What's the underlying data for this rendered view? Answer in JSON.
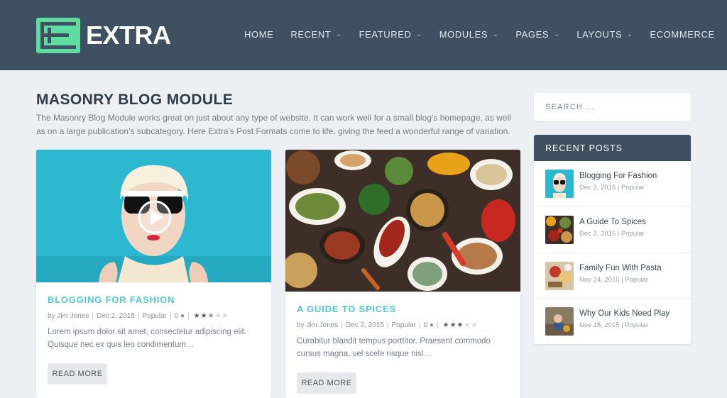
{
  "header": {
    "logo_text": "EXTRA",
    "nav": [
      {
        "label": "HOME",
        "has_dropdown": false
      },
      {
        "label": "RECENT",
        "has_dropdown": true
      },
      {
        "label": "FEATURED",
        "has_dropdown": true
      },
      {
        "label": "MODULES",
        "has_dropdown": true
      },
      {
        "label": "PAGES",
        "has_dropdown": true
      },
      {
        "label": "LAYOUTS",
        "has_dropdown": true
      },
      {
        "label": "ECOMMERCE",
        "has_dropdown": false
      }
    ]
  },
  "main": {
    "title": "MASONRY BLOG MODULE",
    "description": "The Masonry Blog Module works great on just about any type of website. It can work well for a small blog’s homepage, as well as on a large publication’s subcategory. Here Extra’s Post Formats come to life, giving the feed a wonderful range of variation.",
    "posts": [
      {
        "title": "BLOGGING FOR FASHION",
        "author": "by Jim Jones",
        "date": "Dec 2, 2015",
        "category": "Popular",
        "comments": "0",
        "rating": 2.5,
        "excerpt": "Lorem ipsum dolor sit amet, consectetur adipiscing elit. Quisque nec ex quis leo condimentum…",
        "read_more": "READ MORE"
      },
      {
        "title": "A GUIDE TO SPICES",
        "author": "by Jim Jones",
        "date": "Dec 2, 2015",
        "category": "Popular",
        "comments": "0",
        "rating": 3,
        "excerpt": "Curabitur blandit tempus porttitor. Praesent commodo cursus magna, vel scele risque nisl…",
        "read_more": "READ MORE"
      }
    ]
  },
  "sidebar": {
    "search_placeholder": "SEARCH ...",
    "recent_title": "RECENT POSTS",
    "recent_posts": [
      {
        "title": "Blogging For Fashion",
        "date": "Dec 2, 2015",
        "category": "Popular"
      },
      {
        "title": "A Guide To Spices",
        "date": "Dec 2, 2015",
        "category": "Popular"
      },
      {
        "title": "Family Fun With Pasta",
        "date": "Nov 24, 2015",
        "category": "Popular"
      },
      {
        "title": "Why Our Kids Need Play",
        "date": "Nov 18, 2015",
        "category": "Popular"
      }
    ]
  },
  "colors": {
    "header_bg": "#3e5062",
    "accent_green": "#5fdca0",
    "post_title": "#52c6d6",
    "page_bg": "#ecf0f5"
  }
}
